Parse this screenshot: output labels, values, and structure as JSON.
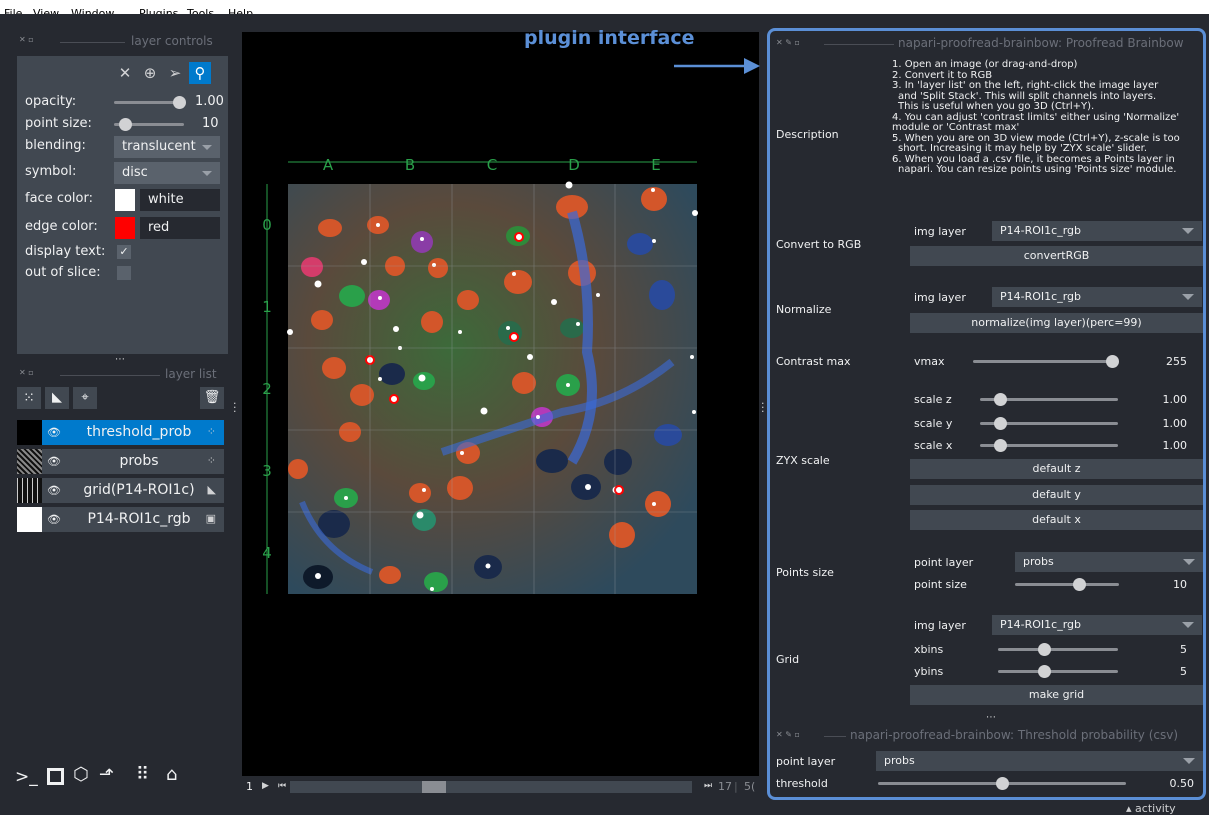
{
  "menubar": {
    "items": [
      "File",
      "View",
      "Window",
      "Plugins",
      "Tools",
      "Help"
    ]
  },
  "layer_controls": {
    "header": "layer controls",
    "opacity_label": "opacity:",
    "opacity_value": "1.00",
    "point_size_label": "point size:",
    "point_size_value": "10",
    "blending_label": "blending:",
    "blending_value": "translucent",
    "symbol_label": "symbol:",
    "symbol_value": "disc",
    "face_color_label": "face color:",
    "face_color_value": "white",
    "edge_color_label": "edge color:",
    "edge_color_value": "red",
    "display_text_label": "display text:",
    "display_text_checked": true,
    "out_of_slice_label": "out of slice:",
    "out_of_slice_checked": false,
    "colors": {
      "face": "#ffffff",
      "edge": "#ff0000",
      "accent": "#007acc"
    }
  },
  "layer_list": {
    "header": "layer list",
    "layers": [
      {
        "name": "threshold_prob",
        "type": "points-icon",
        "selected": true
      },
      {
        "name": "probs",
        "type": "points-icon",
        "selected": false
      },
      {
        "name": "grid(P14-ROI1c)",
        "type": "shapes-icon",
        "selected": false
      },
      {
        "name": "P14-ROI1c_rgb",
        "type": "image-icon",
        "selected": false
      }
    ]
  },
  "canvas": {
    "column_labels": [
      "A",
      "B",
      "C",
      "D",
      "E"
    ],
    "row_labels": [
      "0",
      "1",
      "2",
      "3",
      "4"
    ],
    "slider_start": "1",
    "slider_end": "17",
    "slider_total": "5("
  },
  "annotation": {
    "text": "plugin interface",
    "color": "#5b8fd6"
  },
  "plugin": {
    "title": "napari-proofread-brainbow: Proofread Brainbow",
    "description_label": "Description",
    "description_lines": [
      "1. Open an image (or drag-and-drop)",
      "2. Convert it to RGB",
      "3. In 'layer list' on the left, right-click the image layer",
      "and 'Split Stack'. This will split channels into layers.",
      "This is useful when you go 3D (Ctrl+Y).",
      "4. You can adjust 'contrast limits' either using 'Normalize'",
      "module or 'Contrast max'",
      "5. When you are on 3D view mode (Ctrl+Y), z-scale is too",
      "short. Increasing it may help by 'ZYX scale' slider.",
      "6. When you load a .csv file, it becomes a Points layer in",
      "napari. You can resize points using 'Points size' module."
    ],
    "convert_label": "Convert to RGB",
    "img_layer_label": "img layer",
    "img_layer_value": "P14-ROI1c_rgb",
    "convert_button": "convertRGB",
    "normalize_label": "Normalize",
    "normalize_button": "normalize(img layer)(perc=99)",
    "contrast_label": "Contrast max",
    "vmax_label": "vmax",
    "vmax_value": "255",
    "zyx_label": "ZYX scale",
    "scale_z_label": "scale z",
    "scale_z_value": "1.00",
    "scale_y_label": "scale y",
    "scale_y_value": "1.00",
    "scale_x_label": "scale x",
    "scale_x_value": "1.00",
    "default_z": "default z",
    "default_y": "default y",
    "default_x": "default x",
    "points_size_label": "Points size",
    "point_layer_label": "point layer",
    "point_layer_value": "probs",
    "point_size_label": "point size",
    "point_size_value": "10",
    "grid_label": "Grid",
    "xbins_label": "xbins",
    "xbins_value": "5",
    "ybins_label": "ybins",
    "ybins_value": "5",
    "make_grid_button": "make grid"
  },
  "threshold_plugin": {
    "title": "napari-proofread-brainbow: Threshold probability (csv)",
    "point_layer_label": "point layer",
    "point_layer_value": "probs",
    "threshold_label": "threshold",
    "threshold_value": "0.50"
  },
  "status": {
    "activity": "activity"
  }
}
